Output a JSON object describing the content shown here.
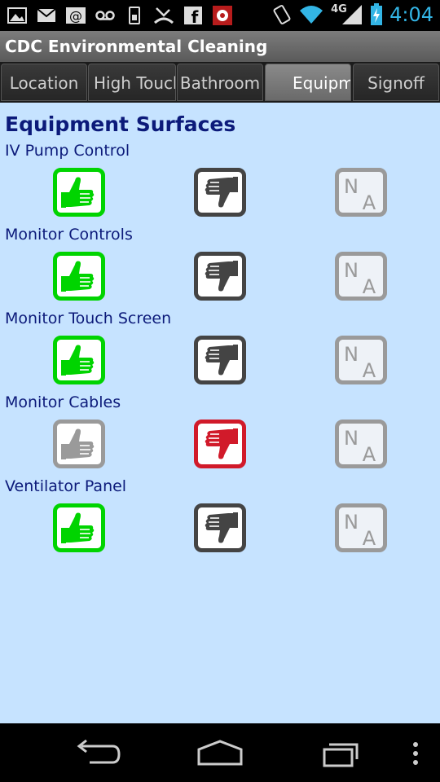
{
  "status_bar": {
    "time": "4:04",
    "network": "4G",
    "left_icons": [
      "gallery-icon",
      "gmail-icon",
      "email-icon",
      "voicemail-icon",
      "sim-icon",
      "missed-call-icon",
      "facebook-icon",
      "app-notification-icon"
    ],
    "right_icons": [
      "rotate-icon",
      "wifi-icon",
      "signal-icon",
      "battery-icon"
    ]
  },
  "app_title": "CDC Environmental Cleaning",
  "tabs": [
    {
      "label": "Location"
    },
    {
      "label": "High Touch"
    },
    {
      "label": "Bathroom"
    },
    {
      "label": "Equipment"
    },
    {
      "label": "Signoff"
    }
  ],
  "active_tab": "Equipment",
  "section_title": "Equipment Surfaces",
  "items": [
    {
      "label": "IV Pump Control",
      "selected": "up"
    },
    {
      "label": "Monitor Controls",
      "selected": "up"
    },
    {
      "label": "Monitor Touch Screen",
      "selected": "up"
    },
    {
      "label": "Monitor Cables",
      "selected": "down"
    },
    {
      "label": "Ventilator Panel",
      "selected": "up"
    }
  ],
  "na_label": "NA",
  "colors": {
    "up_selected": "#00d400",
    "down_selected": "#d11a2a",
    "unselected_up": "#9a9a9a",
    "unselected_down": "#444444",
    "na": "#9a9a9a",
    "content_bg": "#c6e3ff",
    "text": "#0c1a7a",
    "status_time": "#33b5e5"
  },
  "nav": [
    "back-icon",
    "home-icon",
    "recents-icon",
    "menu-icon"
  ]
}
